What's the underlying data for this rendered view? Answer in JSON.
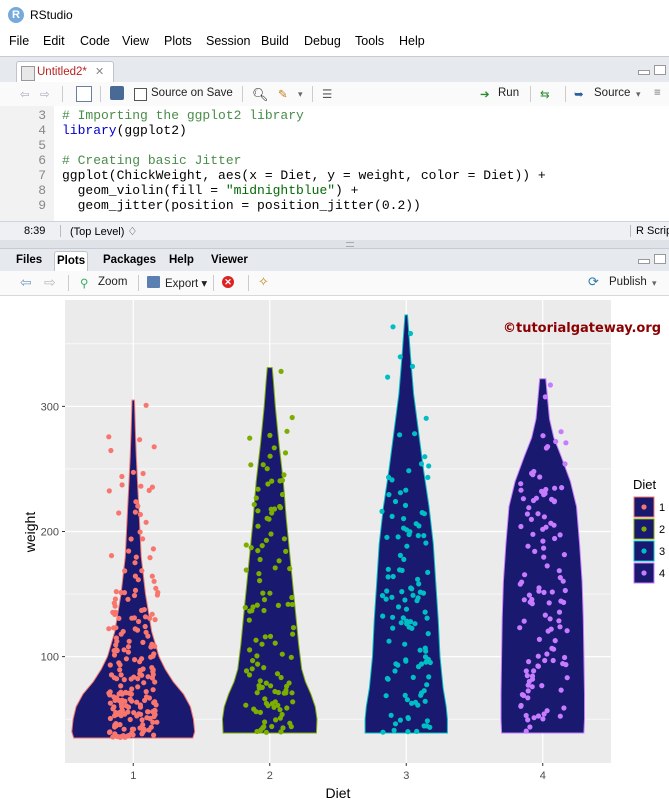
{
  "window": {
    "title": "RStudio",
    "logo": "R"
  },
  "menu": [
    "File",
    "Edit",
    "Code",
    "View",
    "Plots",
    "Session",
    "Build",
    "Debug",
    "Tools",
    "Help"
  ],
  "editor": {
    "tab_label": "Untitled2*",
    "source_on_save": "Source on Save",
    "run_label": "Run",
    "source_label": "Source",
    "lines": [
      {
        "n": "3",
        "parts": [
          {
            "t": "# Importing the ggplot2 library",
            "c": "com"
          }
        ]
      },
      {
        "n": "4",
        "parts": [
          {
            "t": "library",
            "c": "kw"
          },
          {
            "t": "(ggplot2)",
            "c": ""
          }
        ]
      },
      {
        "n": "5",
        "parts": []
      },
      {
        "n": "6",
        "parts": [
          {
            "t": "# Creating basic Jitter",
            "c": "com"
          }
        ]
      },
      {
        "n": "7",
        "parts": [
          {
            "t": "ggplot(ChickWeight, aes(x = Diet, y = weight, color = Diet)) +",
            "c": ""
          }
        ]
      },
      {
        "n": "8",
        "parts": [
          {
            "t": "  geom_violin(fill = ",
            "c": ""
          },
          {
            "t": "\"midnightblue\"",
            "c": "str"
          },
          {
            "t": ") +",
            "c": ""
          }
        ]
      },
      {
        "n": "9",
        "parts": [
          {
            "t": "  geom_jitter(position = position_jitter(0.2))",
            "c": ""
          }
        ]
      }
    ],
    "status": {
      "position": "8:39",
      "scope": "(Top Level) ♢",
      "filetype": "R Script"
    }
  },
  "lower_pane": {
    "tabs": [
      "Files",
      "Plots",
      "Packages",
      "Help",
      "Viewer"
    ],
    "active_tab": "Plots",
    "zoom_label": "Zoom",
    "export_label": "Export ▾",
    "publish_label": "Publish"
  },
  "watermark": "©tutorialgateway.org",
  "colors": {
    "panel_bg": "#ebebeb",
    "violin_fill": "#191970",
    "diet1": "#f8766d",
    "diet2": "#7cae00",
    "diet3": "#00bfc4",
    "diet4": "#c77cff",
    "watermark": "#8b0000"
  },
  "chart_data": {
    "type": "violin",
    "xlabel": "Diet",
    "ylabel": "weight",
    "categories": [
      "1",
      "2",
      "3",
      "4"
    ],
    "yticks": [
      100,
      200,
      300
    ],
    "ylim": [
      15,
      385
    ],
    "legend": {
      "title": "Diet",
      "entries": [
        "1",
        "2",
        "3",
        "4"
      ],
      "position": "right"
    },
    "series": [
      {
        "name": "1",
        "min": 35,
        "max": 305,
        "profile": [
          [
            35,
            0.97
          ],
          [
            40,
            1.0
          ],
          [
            50,
            0.98
          ],
          [
            60,
            0.93
          ],
          [
            70,
            0.82
          ],
          [
            80,
            0.65
          ],
          [
            90,
            0.52
          ],
          [
            100,
            0.42
          ],
          [
            120,
            0.3
          ],
          [
            150,
            0.2
          ],
          [
            180,
            0.13
          ],
          [
            210,
            0.1
          ],
          [
            240,
            0.07
          ],
          [
            260,
            0.05
          ],
          [
            280,
            0.035
          ],
          [
            305,
            0.02
          ]
        ]
      },
      {
        "name": "2",
        "min": 39,
        "max": 331,
        "profile": [
          [
            39,
            0.76
          ],
          [
            50,
            0.77
          ],
          [
            60,
            0.74
          ],
          [
            70,
            0.67
          ],
          [
            80,
            0.58
          ],
          [
            90,
            0.52
          ],
          [
            110,
            0.47
          ],
          [
            130,
            0.43
          ],
          [
            150,
            0.39
          ],
          [
            180,
            0.33
          ],
          [
            210,
            0.27
          ],
          [
            240,
            0.22
          ],
          [
            270,
            0.15
          ],
          [
            300,
            0.09
          ],
          [
            320,
            0.06
          ],
          [
            331,
            0.04
          ]
        ]
      },
      {
        "name": "3",
        "min": 39,
        "max": 373,
        "profile": [
          [
            39,
            0.67
          ],
          [
            50,
            0.67
          ],
          [
            60,
            0.65
          ],
          [
            75,
            0.6
          ],
          [
            100,
            0.55
          ],
          [
            130,
            0.52
          ],
          [
            160,
            0.48
          ],
          [
            190,
            0.44
          ],
          [
            220,
            0.37
          ],
          [
            250,
            0.28
          ],
          [
            280,
            0.2
          ],
          [
            310,
            0.12
          ],
          [
            340,
            0.07
          ],
          [
            360,
            0.04
          ],
          [
            373,
            0.02
          ]
        ]
      },
      {
        "name": "4",
        "min": 39,
        "max": 322,
        "profile": [
          [
            39,
            0.67
          ],
          [
            50,
            0.68
          ],
          [
            70,
            0.68
          ],
          [
            100,
            0.67
          ],
          [
            130,
            0.66
          ],
          [
            160,
            0.64
          ],
          [
            190,
            0.6
          ],
          [
            220,
            0.55
          ],
          [
            240,
            0.45
          ],
          [
            260,
            0.3
          ],
          [
            275,
            0.18
          ],
          [
            290,
            0.11
          ],
          [
            305,
            0.08
          ],
          [
            322,
            0.05
          ]
        ]
      }
    ],
    "points_per_group": [
      220,
      120,
      120,
      118
    ]
  }
}
